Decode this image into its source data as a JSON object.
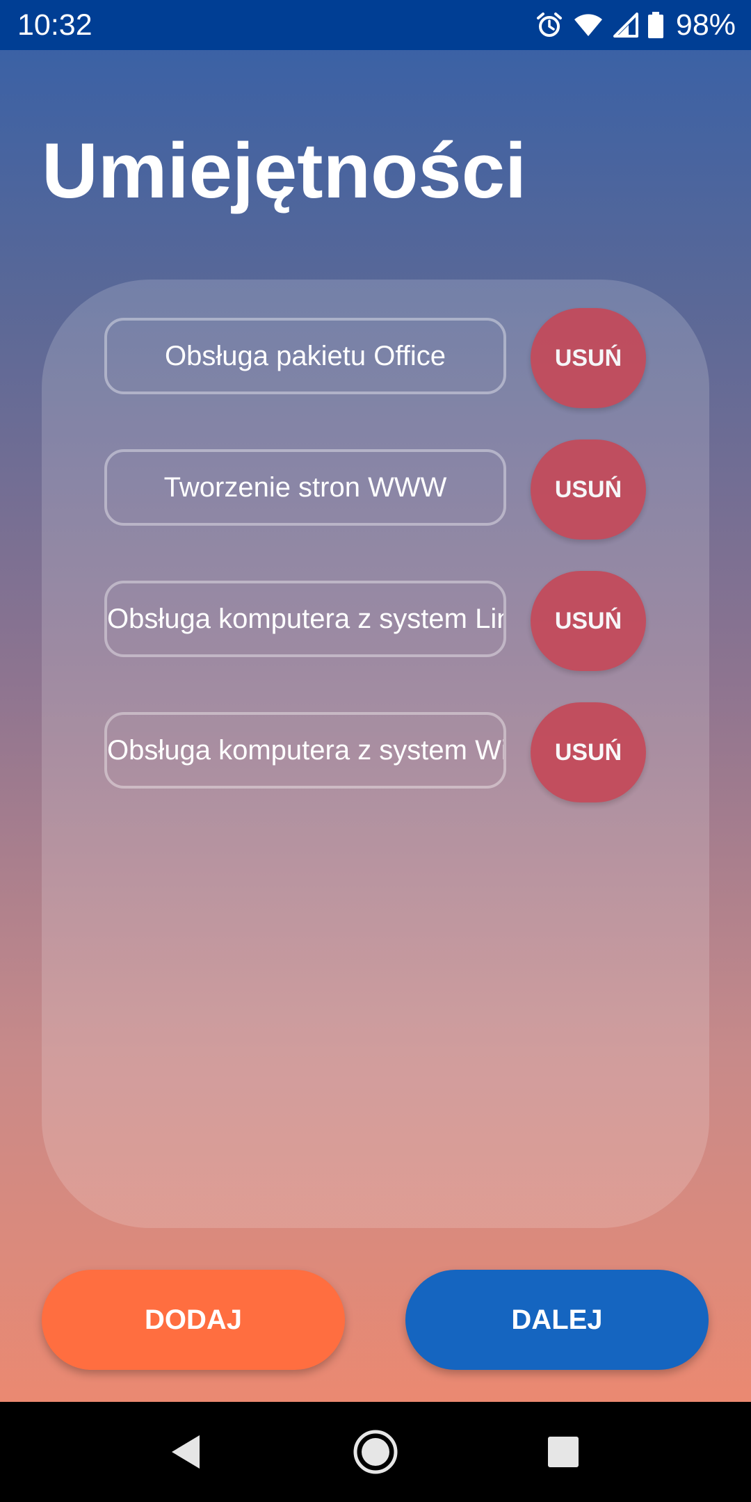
{
  "status_bar": {
    "time": "10:32",
    "battery": "98%",
    "icons": [
      "alarm-icon",
      "wifi-icon",
      "signal-icon",
      "battery-icon"
    ]
  },
  "page": {
    "title": "Umiejętności"
  },
  "skills": [
    {
      "name": "Obsługa pakietu Office",
      "remove_label": "USUŃ"
    },
    {
      "name": "Tworzenie stron WWW",
      "remove_label": "USUŃ"
    },
    {
      "name": "Obsługa komputera z system Linux",
      "remove_label": "USUŃ"
    },
    {
      "name": "Obsługa komputera z system Windows",
      "remove_label": "USUŃ"
    }
  ],
  "actions": {
    "add_label": "DODAJ",
    "next_label": "DALEJ"
  },
  "colors": {
    "status_bar": "#003e94",
    "remove_button": "#c44a5a",
    "add_button": "#ff6e40",
    "next_button": "#1565c0"
  },
  "nav": {
    "icons": [
      "back-icon",
      "home-icon",
      "recents-icon"
    ]
  }
}
